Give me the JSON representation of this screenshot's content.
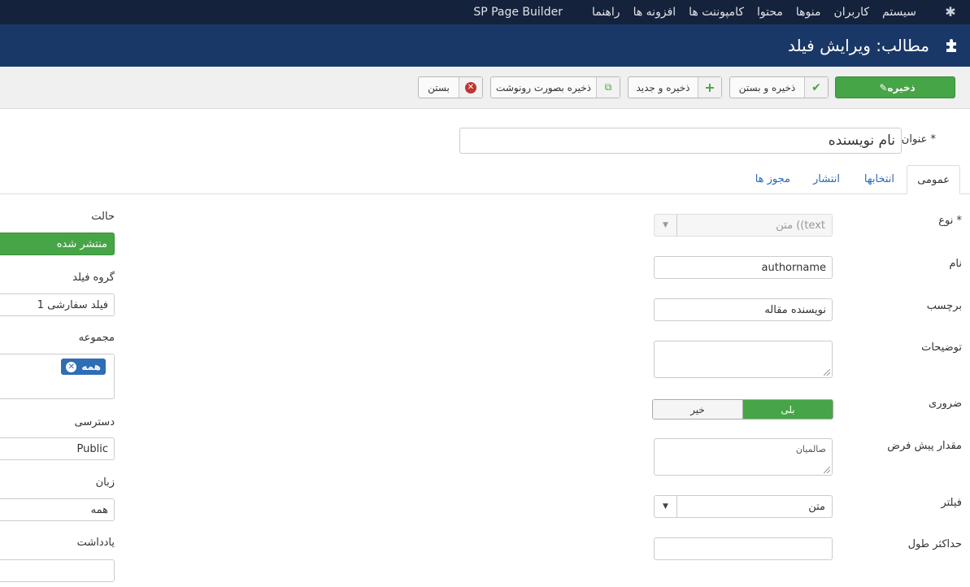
{
  "topbar": {
    "logo_icon": "joomla-icon",
    "menu": [
      "سیستم",
      "کاربران",
      "منوها",
      "محتوا",
      "کامپوننت ها",
      "افزونه ها",
      "راهنما",
      "SP Page Builder"
    ]
  },
  "header": {
    "icon": "puzzle-icon",
    "title": "مطالب: ویرایش فیلد"
  },
  "toolbar": {
    "save": "ذخیره",
    "save_close": "ذخیره و بستن",
    "save_new": "ذخیره و جدید",
    "save_copy": "ذخیره بصورت رونوشت",
    "close": "بستن",
    "colors": {
      "primary": "#46a546",
      "close_icon": "#bd362f",
      "icon_green": "#46a546"
    }
  },
  "title_field": {
    "label": "عنوان *",
    "value": "نام نویسنده"
  },
  "tabs": [
    "عمومی",
    "انتخابها",
    "انتشار",
    "مجوز ها"
  ],
  "main": {
    "type": {
      "label": "نوع *",
      "value": "متن ((text"
    },
    "name": {
      "label": "نام",
      "value": "authorname"
    },
    "field_label": {
      "label": "برچسب",
      "value": "نویسنده مقاله"
    },
    "description": {
      "label": "توضیحات",
      "value": ""
    },
    "required": {
      "label": "ضروری",
      "yes": "بلی",
      "no": "خیر"
    },
    "default_value": {
      "label": "مقدار پیش فرض",
      "value": "صالمیان"
    },
    "filter": {
      "label": "فیلتر",
      "value": "متن"
    },
    "max_length": {
      "label": "حداکثر طول",
      "value": ""
    }
  },
  "side": {
    "status": {
      "label": "حالت",
      "value": "منتشر شده"
    },
    "field_group": {
      "label": "گروه فیلد",
      "value": "فیلد سفارشی 1"
    },
    "category": {
      "label": "مجموعه",
      "chip": "همه"
    },
    "access": {
      "label": "دسترسی",
      "value": "Public"
    },
    "language": {
      "label": "زبان",
      "value": "همه"
    },
    "note": {
      "label": "یادداشت",
      "value": ""
    }
  }
}
